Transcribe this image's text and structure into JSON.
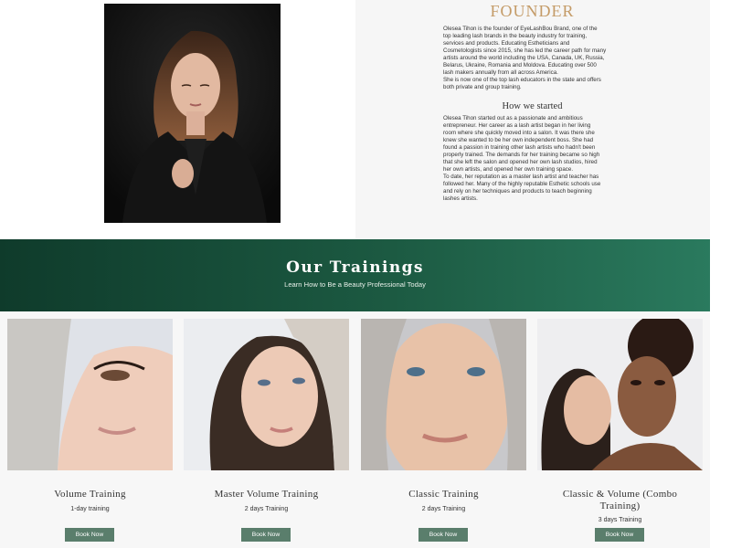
{
  "founder": {
    "title": "FOUNDER",
    "bio_lines": [
      "Olesea Tihon is the founder of EyeLashBou Brand, one of the",
      "top leading lash brands in the beauty industry for training,",
      "services and products. Educating Estheticians and",
      "Cosmetologists since 2015, she has led the career path for many",
      "artists around the world including the USA, Canada, UK, Russia,",
      "Belarus, Ukraine, Romania and Moldova. Educating over 500",
      "lash makers annually from all across America.",
      "She is now one of the top lash educators in the state and offers",
      "both private and group training."
    ],
    "how_title": "How we started",
    "how_lines": [
      "Olesea Tihon started out as a passionate and ambitious",
      "entrepreneur. Her career as a lash artist began in her living",
      "room where she quickly moved into a salon. It was there she",
      "knew she wanted to be her own independent boss. She had",
      "found a passion in training other lash artists who hadn't been",
      "properly trained. The demands for her training became so high",
      "that she left the salon and opened her own lash studios, hired",
      "her own artists, and opened her own training space.",
      "To date, her reputation as a master lash artist and teacher has",
      "followed her. Many of the highly reputable Esthetic schools use",
      "and rely on her techniques and products to teach beginning",
      "lashes artists."
    ]
  },
  "banner": {
    "title": "Our Trainings",
    "subtitle": "Learn How to Be a Beauty Professional Today"
  },
  "trainings": [
    {
      "title": "Volume Training",
      "duration": "1-day training",
      "button": "Book Now",
      "image": "model-eye-closeup-photo"
    },
    {
      "title": "Master Volume Training",
      "duration": "2 days Training",
      "button": "Book Now",
      "image": "model-portrait-photo"
    },
    {
      "title": "Classic Training",
      "duration": "2 days Training",
      "button": "Book Now",
      "image": "model-face-closeup-photo"
    },
    {
      "title": "Classic & Volume (Combo",
      "title_line2": "Training)",
      "duration": "3 days Training",
      "button": "Book Now",
      "image": "two-models-photo"
    }
  ],
  "colors": {
    "accent_gold": "#c49b67",
    "banner_green": "#1c5a42",
    "button_green": "#5a7e6c"
  }
}
